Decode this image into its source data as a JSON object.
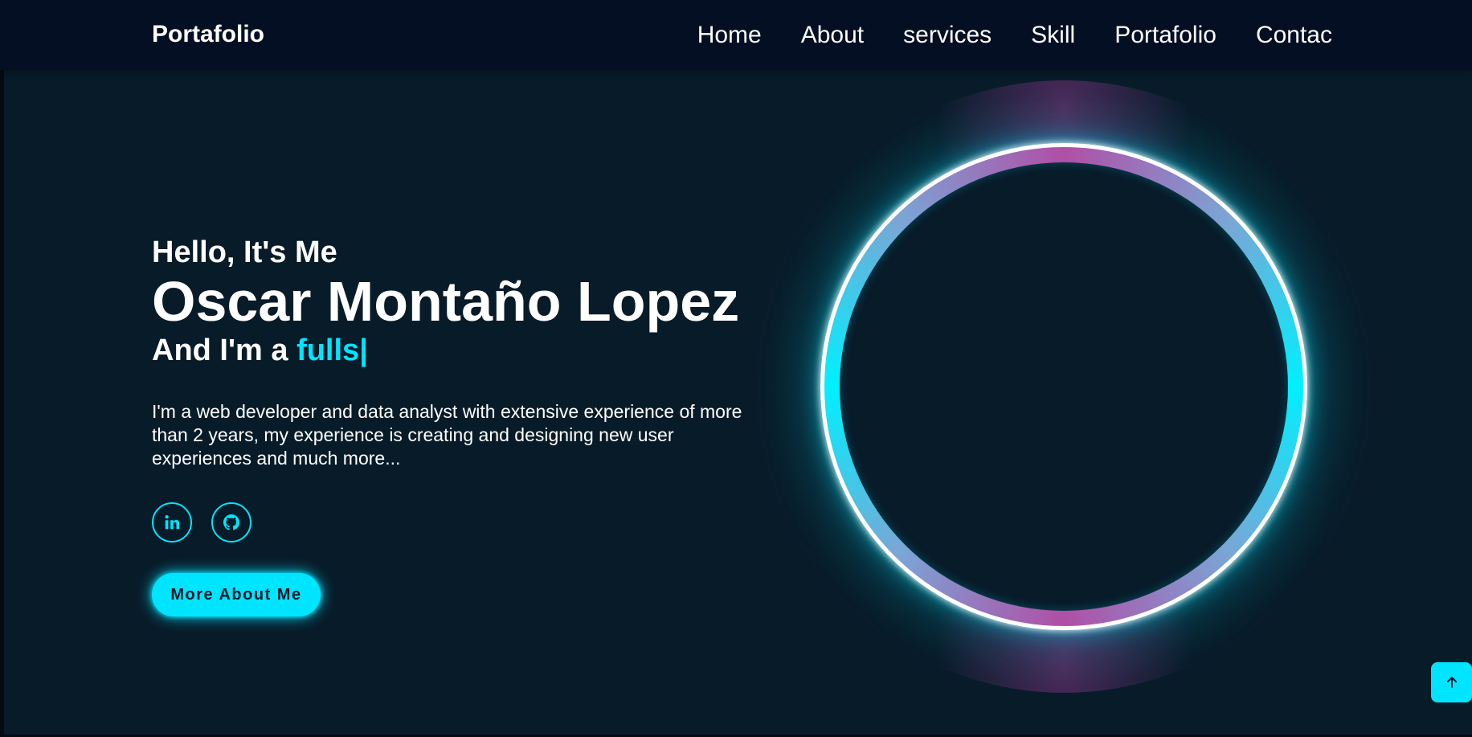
{
  "header": {
    "logo": "Portafolio",
    "nav": [
      "Home",
      "About",
      "services",
      "Skill",
      "Portafolio",
      "Contac"
    ]
  },
  "hero": {
    "greeting": "Hello, It's Me",
    "name": "Oscar Montaño Lopez",
    "role_prefix": "And I'm a ",
    "role_typed": "fulls",
    "cursor": "|",
    "description": "I'm a web developer and data analyst with extensive experience of more than 2 years, my experience is creating and designing new user experiences and much more...",
    "button_label": "More About Me"
  },
  "social": {
    "icons": [
      "linkedin-icon",
      "github-icon"
    ]
  },
  "colors": {
    "background": "#081b29",
    "header": "#050f24",
    "accent": "#00e5ff",
    "ring_pink": "#b04fa6"
  }
}
